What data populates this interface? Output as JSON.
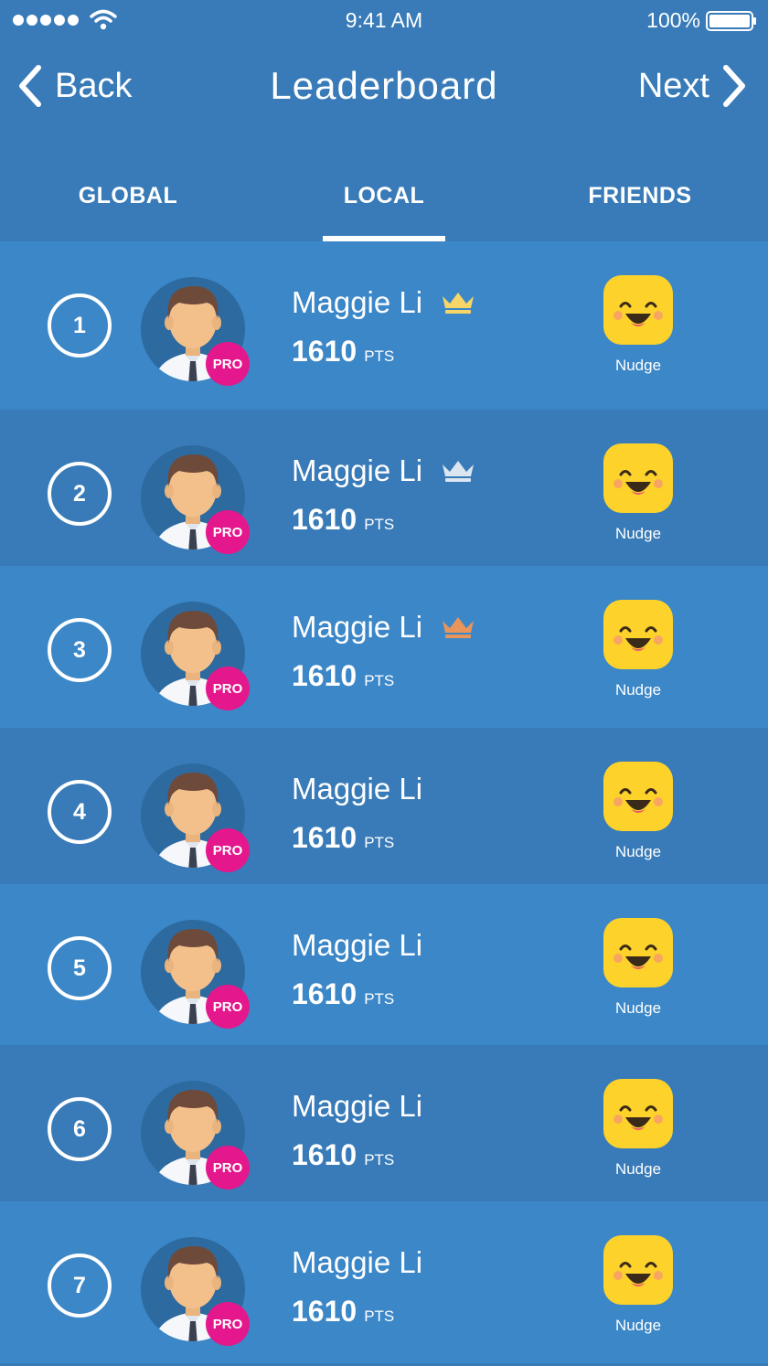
{
  "status_bar": {
    "time": "9:41 AM",
    "battery": "100%"
  },
  "nav": {
    "back_label": "Back",
    "title": "Leaderboard",
    "next_label": "Next"
  },
  "tabs": [
    {
      "label": "GLOBAL",
      "active": false
    },
    {
      "label": "LOCAL",
      "active": true
    },
    {
      "label": "FRIENDS",
      "active": false
    }
  ],
  "colors": {
    "background": "#387bb8",
    "row_alt": "#3b87c8",
    "pro_badge": "#e5178c",
    "nudge": "#fdd22b",
    "crown_gold": "#f7d566",
    "crown_silver": "#dce6f0",
    "crown_bronze": "#e8945a"
  },
  "rows": [
    {
      "rank": "1",
      "name": "Maggie Li",
      "points": "1610",
      "unit": "PTS",
      "badge": "PRO",
      "crown": "gold",
      "nudge": "Nudge"
    },
    {
      "rank": "2",
      "name": "Maggie Li",
      "points": "1610",
      "unit": "PTS",
      "badge": "PRO",
      "crown": "silver",
      "nudge": "Nudge"
    },
    {
      "rank": "3",
      "name": "Maggie Li",
      "points": "1610",
      "unit": "PTS",
      "badge": "PRO",
      "crown": "bronze",
      "nudge": "Nudge"
    },
    {
      "rank": "4",
      "name": "Maggie Li",
      "points": "1610",
      "unit": "PTS",
      "badge": "PRO",
      "crown": null,
      "nudge": "Nudge"
    },
    {
      "rank": "5",
      "name": "Maggie Li",
      "points": "1610",
      "unit": "PTS",
      "badge": "PRO",
      "crown": null,
      "nudge": "Nudge"
    },
    {
      "rank": "6",
      "name": "Maggie Li",
      "points": "1610",
      "unit": "PTS",
      "badge": "PRO",
      "crown": null,
      "nudge": "Nudge"
    },
    {
      "rank": "7",
      "name": "Maggie Li",
      "points": "1610",
      "unit": "PTS",
      "badge": "PRO",
      "crown": null,
      "nudge": "Nudge"
    }
  ]
}
